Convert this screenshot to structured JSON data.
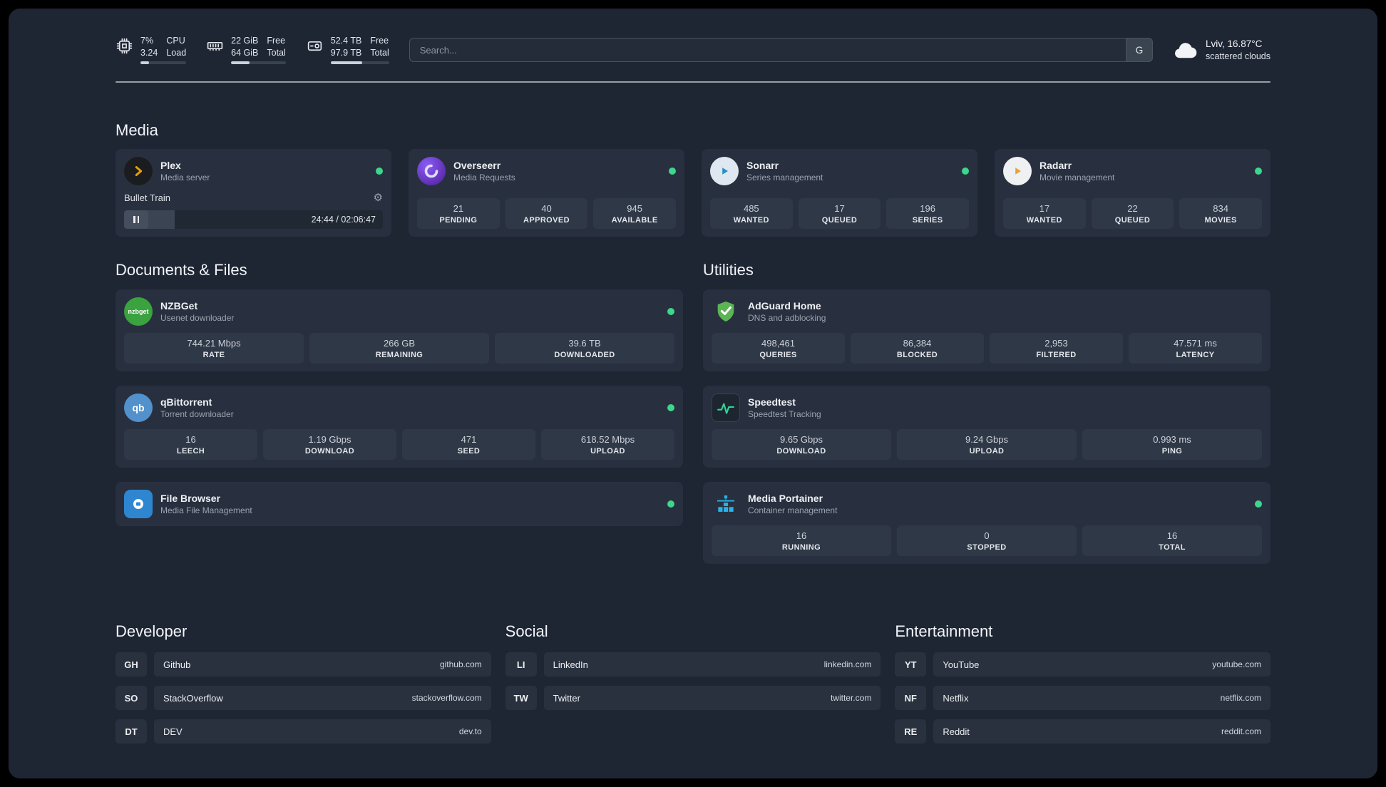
{
  "topbar": {
    "cpu": {
      "v1": "7%",
      "v2": "3.24",
      "l1": "CPU",
      "l2": "Load",
      "progress": 18
    },
    "mem": {
      "v1": "22 GiB",
      "v2": "64 GiB",
      "l1": "Free",
      "l2": "Total",
      "progress": 34
    },
    "disk": {
      "v1": "52.4 TB",
      "v2": "97.9 TB",
      "l1": "Free",
      "l2": "Total",
      "progress": 54
    },
    "search": {
      "placeholder": "Search...",
      "provider": "G"
    },
    "weather": {
      "location": "Lviv, 16.87°C",
      "condition": "scattered clouds"
    }
  },
  "media": {
    "title": "Media",
    "plex": {
      "name": "Plex",
      "desc": "Media server",
      "now_playing": "Bullet Train",
      "time": "24:44 / 02:06:47",
      "progress": 19.5
    },
    "overseerr": {
      "name": "Overseerr",
      "desc": "Media Requests",
      "stats": [
        {
          "value": "21",
          "label": "PENDING"
        },
        {
          "value": "40",
          "label": "APPROVED"
        },
        {
          "value": "945",
          "label": "AVAILABLE"
        }
      ]
    },
    "sonarr": {
      "name": "Sonarr",
      "desc": "Series management",
      "stats": [
        {
          "value": "485",
          "label": "WANTED"
        },
        {
          "value": "17",
          "label": "QUEUED"
        },
        {
          "value": "196",
          "label": "SERIES"
        }
      ]
    },
    "radarr": {
      "name": "Radarr",
      "desc": "Movie management",
      "stats": [
        {
          "value": "17",
          "label": "WANTED"
        },
        {
          "value": "22",
          "label": "QUEUED"
        },
        {
          "value": "834",
          "label": "MOVIES"
        }
      ]
    }
  },
  "docs": {
    "title": "Documents & Files",
    "nzbget": {
      "name": "NZBGet",
      "desc": "Usenet downloader",
      "stats": [
        {
          "value": "744.21 Mbps",
          "label": "RATE"
        },
        {
          "value": "266 GB",
          "label": "REMAINING"
        },
        {
          "value": "39.6 TB",
          "label": "DOWNLOADED"
        }
      ]
    },
    "qbit": {
      "name": "qBittorrent",
      "desc": "Torrent downloader",
      "stats": [
        {
          "value": "16",
          "label": "LEECH"
        },
        {
          "value": "1.19 Gbps",
          "label": "DOWNLOAD"
        },
        {
          "value": "471",
          "label": "SEED"
        },
        {
          "value": "618.52 Mbps",
          "label": "UPLOAD"
        }
      ]
    },
    "filebrowser": {
      "name": "File Browser",
      "desc": "Media File Management"
    }
  },
  "utils": {
    "title": "Utilities",
    "adguard": {
      "name": "AdGuard Home",
      "desc": "DNS and adblocking",
      "stats": [
        {
          "value": "498,461",
          "label": "QUERIES"
        },
        {
          "value": "86,384",
          "label": "BLOCKED"
        },
        {
          "value": "2,953",
          "label": "FILTERED"
        },
        {
          "value": "47.571 ms",
          "label": "LATENCY"
        }
      ]
    },
    "speedtest": {
      "name": "Speedtest",
      "desc": "Speedtest Tracking",
      "stats": [
        {
          "value": "9.65 Gbps",
          "label": "DOWNLOAD"
        },
        {
          "value": "9.24 Gbps",
          "label": "UPLOAD"
        },
        {
          "value": "0.993 ms",
          "label": "PING"
        }
      ]
    },
    "portainer": {
      "name": "Media Portainer",
      "desc": "Container management",
      "stats": [
        {
          "value": "16",
          "label": "RUNNING"
        },
        {
          "value": "0",
          "label": "STOPPED"
        },
        {
          "value": "16",
          "label": "TOTAL"
        }
      ]
    }
  },
  "bookmarks": {
    "dev": {
      "title": "Developer",
      "items": [
        {
          "abbr": "GH",
          "name": "Github",
          "url": "github.com"
        },
        {
          "abbr": "SO",
          "name": "StackOverflow",
          "url": "stackoverflow.com"
        },
        {
          "abbr": "DT",
          "name": "DEV",
          "url": "dev.to"
        }
      ]
    },
    "social": {
      "title": "Social",
      "items": [
        {
          "abbr": "LI",
          "name": "LinkedIn",
          "url": "linkedin.com"
        },
        {
          "abbr": "TW",
          "name": "Twitter",
          "url": "twitter.com"
        }
      ]
    },
    "ent": {
      "title": "Entertainment",
      "items": [
        {
          "abbr": "YT",
          "name": "YouTube",
          "url": "youtube.com"
        },
        {
          "abbr": "NF",
          "name": "Netflix",
          "url": "netflix.com"
        },
        {
          "abbr": "RE",
          "name": "Reddit",
          "url": "reddit.com"
        }
      ]
    }
  },
  "icons": {
    "gear": "⚙",
    "nzbget_label": "nzbget",
    "qb_label": "qb"
  }
}
